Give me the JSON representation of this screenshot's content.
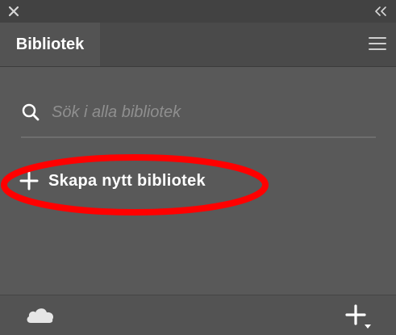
{
  "panel": {
    "tab_label": "Bibliotek"
  },
  "search": {
    "placeholder": "Sök i alla bibliotek",
    "value": ""
  },
  "actions": {
    "create_label": "Skapa nytt bibliotek"
  },
  "icons": {
    "close": "close-icon",
    "collapse": "collapse-icon",
    "menu": "hamburger-menu-icon",
    "search": "search-icon",
    "plus": "plus-icon",
    "cloud": "cloud-icon",
    "add": "add-with-dropdown-icon"
  },
  "colors": {
    "highlight_ring": "#ff0000",
    "panel_bg": "#595959",
    "text": "#ffffff",
    "placeholder": "#8f8f8f"
  }
}
